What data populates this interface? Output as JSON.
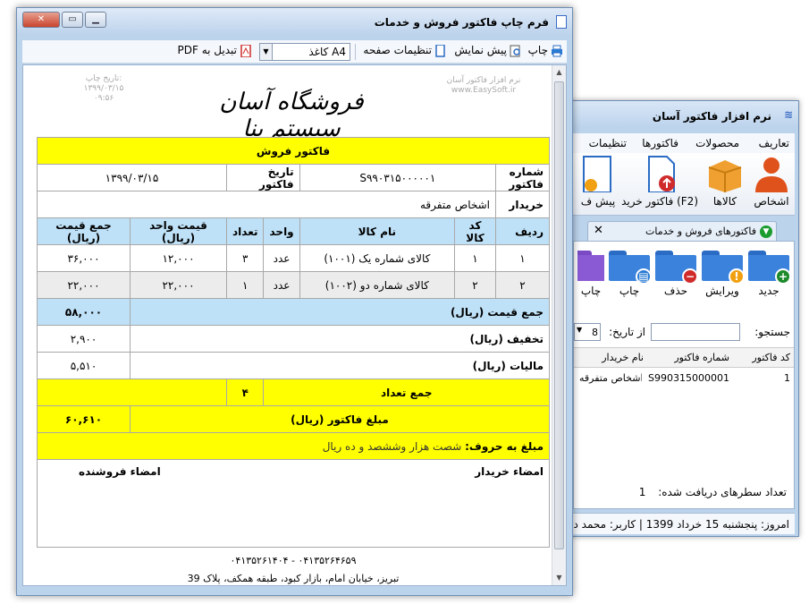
{
  "bg_window": {
    "title": "نرم افزار فاکتور آسان",
    "menu": [
      "تعاریف",
      "محصولات",
      "فاکتورها",
      "تنظیمات"
    ],
    "ribbon": [
      {
        "label": "اشخاص",
        "icon": "person-icon"
      },
      {
        "label": "کالاها",
        "icon": "box-icon"
      },
      {
        "label": "فاکتور خرید (F2)",
        "icon": "purchase-invoice-icon"
      },
      {
        "label": "پیش ف",
        "icon": "preinvoice-icon"
      }
    ],
    "tab_label": "فاکتورهای فروش و خدمات",
    "actions": [
      {
        "label": "جدید",
        "badge": "+",
        "color": "#1c8a2a",
        "icon": "new-folder-icon"
      },
      {
        "label": "ویرایش",
        "badge": "!",
        "color": "#f0a010",
        "icon": "edit-folder-icon"
      },
      {
        "label": "حذف",
        "badge": "−",
        "color": "#d02b2b",
        "icon": "delete-folder-icon"
      },
      {
        "label": "چاپ",
        "badge": "▤",
        "color": "#2a7bd4",
        "icon": "print-folder-icon"
      },
      {
        "label": "چاپ",
        "badge": "",
        "color": "#7a4ac4",
        "icon": "print-folder-icon"
      }
    ],
    "search_label": "جستجو:",
    "to_date_label": "از تاریخ:",
    "date_value": "8",
    "grid": {
      "columns": [
        "کد فاکتور",
        "شماره فاکتور",
        "نام خریدار"
      ],
      "rows": [
        [
          "1",
          "S990315000001",
          "اشخاص متفرقه"
        ]
      ]
    },
    "rows_count_label": "تعداد سطرهای دریافت شده:",
    "rows_count_value": "1",
    "status": "امروز: پنجشنبه 15 خرداد 1399 | کاربر: محمد د"
  },
  "main_window": {
    "title": "فرم چاپ فاکتور فروش و خدمات",
    "toolbar": {
      "print": "چاپ",
      "preview": "پیش نمایش",
      "page_setup": "تنظیمات صفحه",
      "paper": "کاغذ A4",
      "pdf": "تبدیل به PDF"
    }
  },
  "invoice": {
    "watermark": "نرم افزار فاکتور آسان",
    "website": "www.EasySoft.ir",
    "print_date_label": "تاریخ چاپ:",
    "print_date": "۱۳۹۹/۰۳/۱۵",
    "print_time": "۰۹:۵۶",
    "store_name": "فروشگاه آسان سیستم بنا",
    "title": "فاکتور فروش",
    "number_label": "شماره فاکتور",
    "number": "S۹۹۰۳۱۵۰۰۰۰۰۱",
    "date_label": "تاریخ فاکتور",
    "date": "۱۳۹۹/۰۳/۱۵",
    "buyer_label": "خریدار",
    "buyer": "اشخاص متفرقه",
    "columns": [
      "ردیف",
      "کد کالا",
      "نام کالا",
      "واحد",
      "تعداد",
      "قیمت واحد (ریال)",
      "جمع قیمت (ریال)"
    ],
    "items": [
      {
        "row": "۱",
        "code": "۱",
        "name": "کالای شماره یک (۱۰۰۱)",
        "unit": "عدد",
        "qty": "۳",
        "price": "۱۲,۰۰۰",
        "total": "۳۶,۰۰۰"
      },
      {
        "row": "۲",
        "code": "۲",
        "name": "کالای شماره دو (۱۰۰۲)",
        "unit": "عدد",
        "qty": "۱",
        "price": "۲۲,۰۰۰",
        "total": "۲۲,۰۰۰"
      }
    ],
    "sum_label": "جمع قیمت (ریال)",
    "sum": "۵۸,۰۰۰",
    "discount_label": "تخفیف (ریال)",
    "discount": "۲,۹۰۰",
    "tax_label": "مالیات (ریال)",
    "tax": "۵,۵۱۰",
    "qty_total_label": "جمع تعداد",
    "qty_total": "۴",
    "amount_label": "مبلغ فاکتور (ریال)",
    "amount": "۶۰,۶۱۰",
    "words_label": "مبلغ به حروف:",
    "words": "شصت هزار وششصد و ده ریال",
    "buyer_sign": "امضاء خریدار",
    "seller_sign": "امضاء فروشنده",
    "phones": "۰۴۱۳۵۲۶۴۶۵۹ - ۰۴۱۳۵۲۶۱۴۰۴",
    "address": "تبریز، خیابان امام، بازار کبود، طبقه همکف، پلاک 39"
  }
}
